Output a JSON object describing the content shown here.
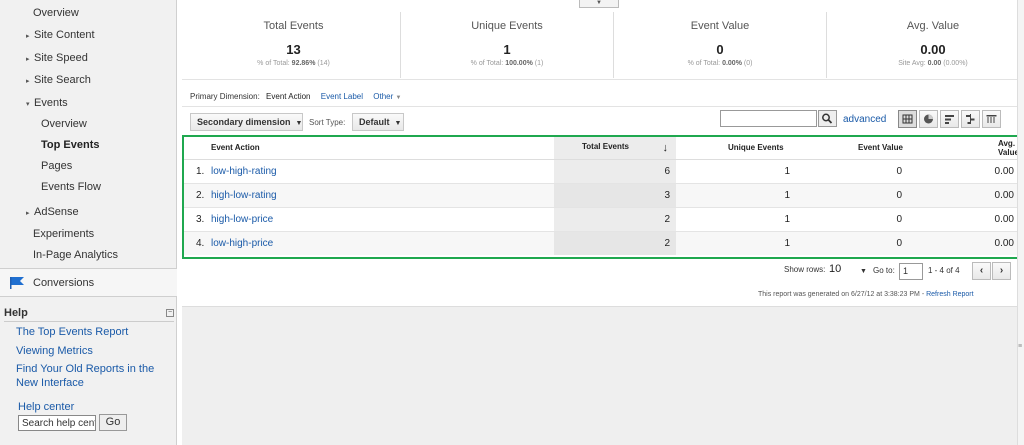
{
  "sidebar": {
    "nav": [
      {
        "label": "Overview"
      },
      {
        "label": "Site Content",
        "arrow": "▸"
      },
      {
        "label": "Site Speed",
        "arrow": "▸"
      },
      {
        "label": "Site Search",
        "arrow": "▸"
      },
      {
        "label": "Events",
        "arrow": "▾"
      },
      {
        "label": "Overview"
      },
      {
        "label": "Top Events"
      },
      {
        "label": "Pages"
      },
      {
        "label": "Events Flow"
      },
      {
        "label": "AdSense",
        "arrow": "▸"
      },
      {
        "label": "Experiments"
      },
      {
        "label": "In-Page Analytics"
      }
    ],
    "conversions": "Conversions",
    "help": {
      "title": "Help",
      "links": [
        "The Top Events Report",
        "Viewing Metrics",
        "Find Your Old Reports in the New Interface"
      ],
      "center": "Help center",
      "search_value": "Search help cent",
      "go": "Go"
    }
  },
  "scorecards": [
    {
      "title": "Total Events",
      "value": "13",
      "sub_prefix": "% of Total: ",
      "sub_bold": "92.86%",
      "sub_suffix": " (14)"
    },
    {
      "title": "Unique Events",
      "value": "1",
      "sub_prefix": "% of Total: ",
      "sub_bold": "100.00%",
      "sub_suffix": " (1)"
    },
    {
      "title": "Event Value",
      "value": "0",
      "sub_prefix": "% of Total: ",
      "sub_bold": "0.00%",
      "sub_suffix": " (0)"
    },
    {
      "title": "Avg. Value",
      "value": "0.00",
      "sub_prefix": "Site Avg: ",
      "sub_bold": "0.00",
      "sub_suffix": " (0.00%)"
    }
  ],
  "dimension": {
    "label": "Primary Dimension:",
    "active": "Event Action",
    "label2": "Event Label",
    "other": "Other"
  },
  "toolbar": {
    "secondary": "Secondary dimension",
    "sort_label": "Sort Type:",
    "sort_value": "Default",
    "advanced": "advanced"
  },
  "table": {
    "headers": [
      "Event Action",
      "Total Events",
      "Unique Events",
      "Event Value",
      "Avg. Value"
    ],
    "sort_arrow": "↓",
    "rows": [
      {
        "idx": "1.",
        "action": "low-high-rating",
        "total": "6",
        "unique": "1",
        "value": "0",
        "avg": "0.00"
      },
      {
        "idx": "2.",
        "action": "high-low-rating",
        "total": "3",
        "unique": "1",
        "value": "0",
        "avg": "0.00"
      },
      {
        "idx": "3.",
        "action": "high-low-price",
        "total": "2",
        "unique": "1",
        "value": "0",
        "avg": "0.00"
      },
      {
        "idx": "4.",
        "action": "low-high-price",
        "total": "2",
        "unique": "1",
        "value": "0",
        "avg": "0.00"
      }
    ]
  },
  "pager": {
    "show_rows": "Show rows:",
    "rows": "10",
    "goto": "Go to:",
    "goto_value": "1",
    "range": "1 - 4 of 4"
  },
  "footer": {
    "generated": "This report was generated on 6/27/12 at 3:38:23 PM - ",
    "refresh": "Refresh Report"
  },
  "colors": {
    "highlight_border": "#1fa84f",
    "link": "#1a5aa8"
  }
}
